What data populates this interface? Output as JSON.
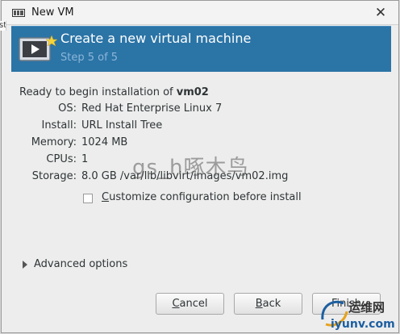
{
  "window": {
    "title": "New VM",
    "side_sliver_text": "st"
  },
  "banner": {
    "title": "Create a new virtual machine",
    "step": "Step 5 of 5"
  },
  "summary": {
    "ready_prefix": "Ready to begin installation of ",
    "vm_name": "vm02",
    "rows": [
      {
        "label": "OS:",
        "value": "Red Hat Enterprise Linux 7"
      },
      {
        "label": "Install:",
        "value": "URL Install Tree"
      },
      {
        "label": "Memory:",
        "value": "1024 MB"
      },
      {
        "label": "CPUs:",
        "value": "1"
      },
      {
        "label": "Storage:",
        "value": "8.0 GB /var/lib/libvirt/images/vm02.img"
      }
    ]
  },
  "customize": {
    "label_accel": "C",
    "label_rest": "ustomize configuration before install",
    "checked": false
  },
  "advanced": {
    "label": "Advanced options"
  },
  "buttons": {
    "cancel_accel": "C",
    "cancel_rest": "ancel",
    "back_accel": "B",
    "back_rest": "ack",
    "finish": "Finish"
  },
  "watermark": {
    "text": "gs_h啄木鸟",
    "logo_cn": "运维网",
    "logo_url": "iyunv.com"
  },
  "colors": {
    "banner": "#2b74a6",
    "banner_step": "#8cb6d9"
  }
}
